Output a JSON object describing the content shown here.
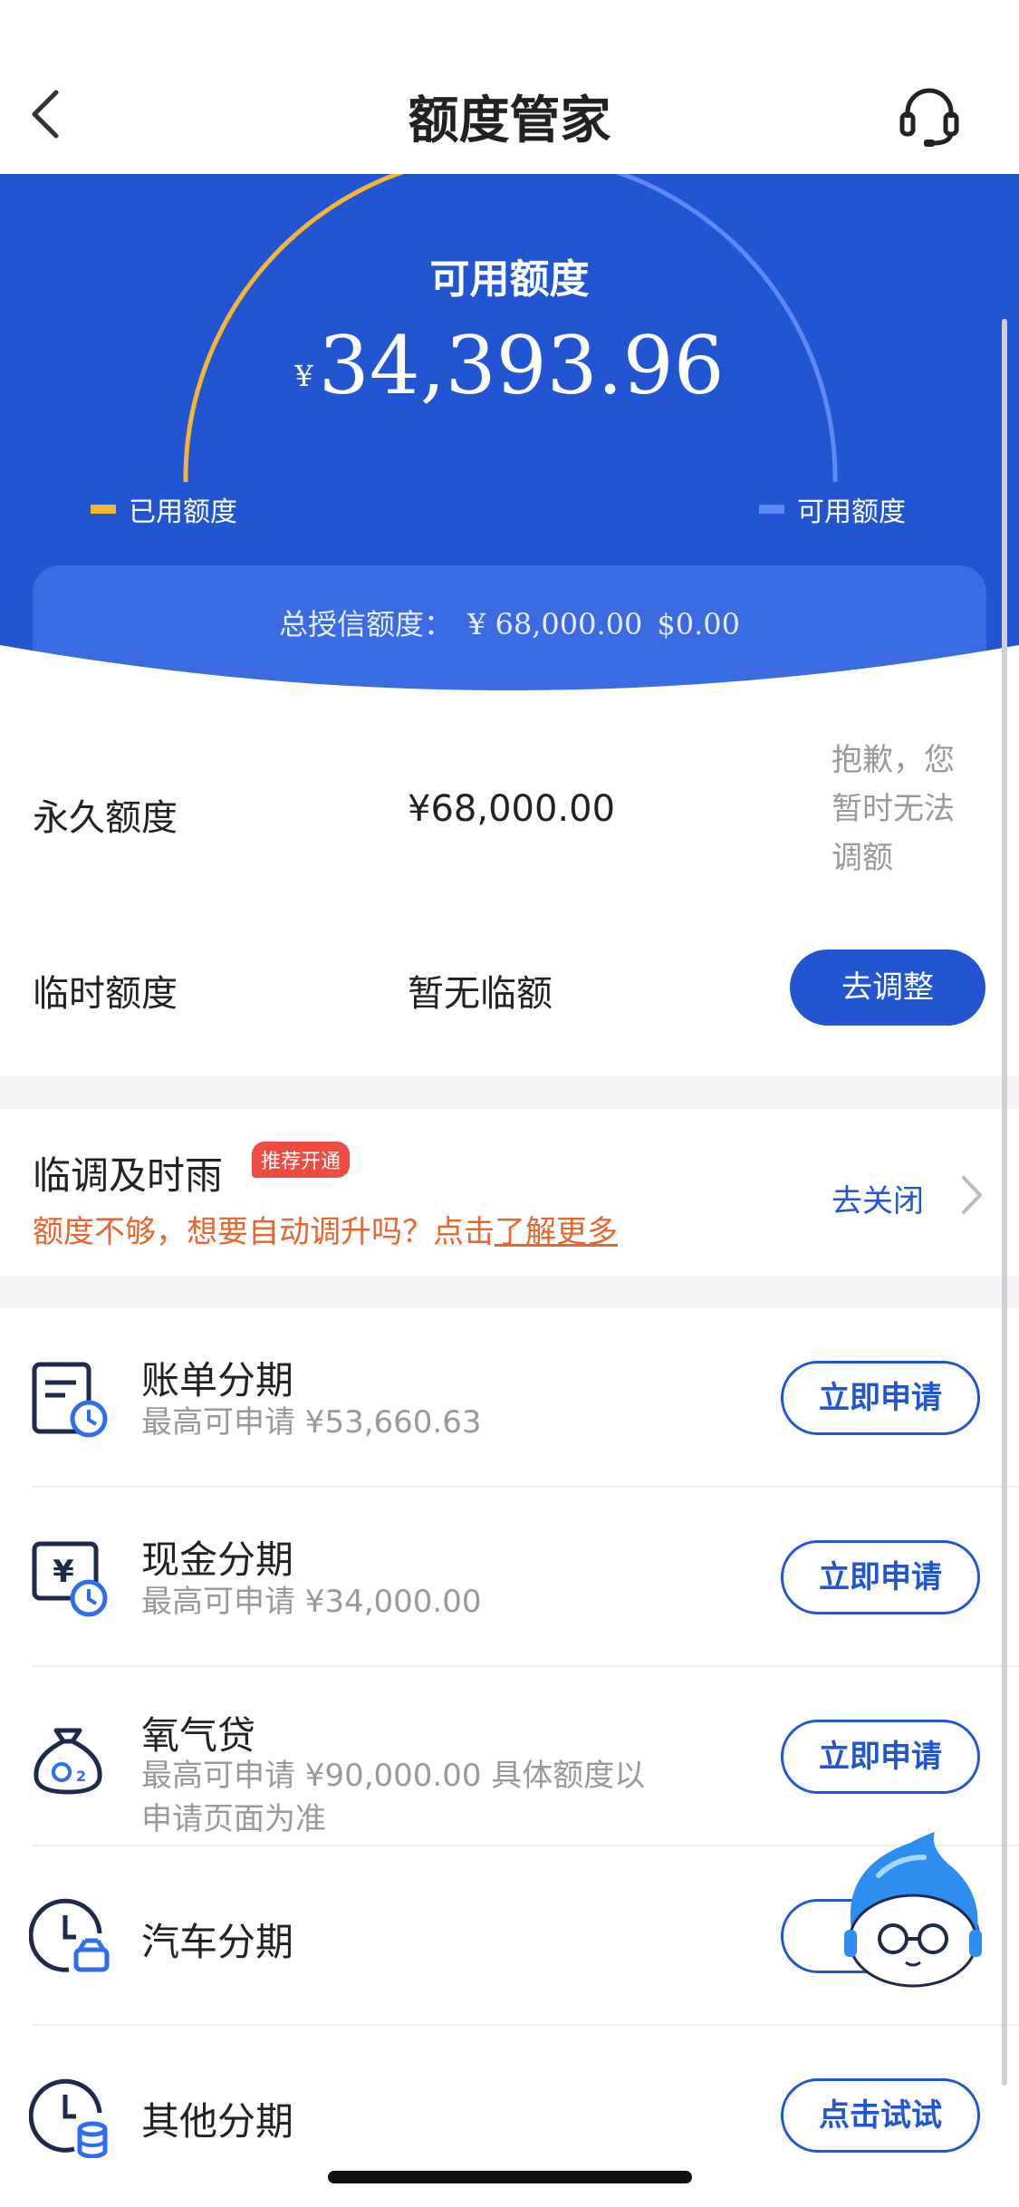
{
  "nav": {
    "title": "额度管家",
    "back_icon": "chevron-left-icon",
    "service_icon": "headset-icon"
  },
  "hero": {
    "title": "可用额度",
    "currency": "¥",
    "amount": "34,393.96",
    "legend_used": "已用额度",
    "legend_available": "可用额度",
    "total_label": "总授信额度：",
    "total_cny": "¥ 68,000.00",
    "total_usd": "$0.00",
    "colors": {
      "background": "#2255d2",
      "used": "#f5b731",
      "available": "#5f87f5"
    }
  },
  "quota": {
    "permanent_label": "永久额度",
    "permanent_value": "¥68,000.00",
    "permanent_note": "抱歉，您暂时无法调额",
    "temporary_label": "临时额度",
    "temporary_value": "暂无临额",
    "adjust_button": "去调整"
  },
  "auto_adjust": {
    "title": "临调及时雨",
    "badge": "推荐开通",
    "subtitle": "额度不够，想要自动调升吗？点击",
    "link": "了解更多",
    "action": "去关闭"
  },
  "products": [
    {
      "name": "账单分期",
      "sub": "最高可申请  ¥53,660.63",
      "button": "立即申请",
      "icon": "bill-installment-icon"
    },
    {
      "name": "现金分期",
      "sub": "最高可申请  ¥34,000.00",
      "button": "立即申请",
      "icon": "cash-installment-icon"
    },
    {
      "name": "氧气贷",
      "sub": "最高可申请  ¥90,000.00  具体额度以申请页面为准",
      "button": "立即申请",
      "icon": "money-bag-icon"
    },
    {
      "name": "汽车分期",
      "sub": "",
      "button": "点",
      "icon": "car-installment-icon"
    },
    {
      "name": "其他分期",
      "sub": "",
      "button": "点击试试",
      "icon": "other-installment-icon"
    }
  ]
}
